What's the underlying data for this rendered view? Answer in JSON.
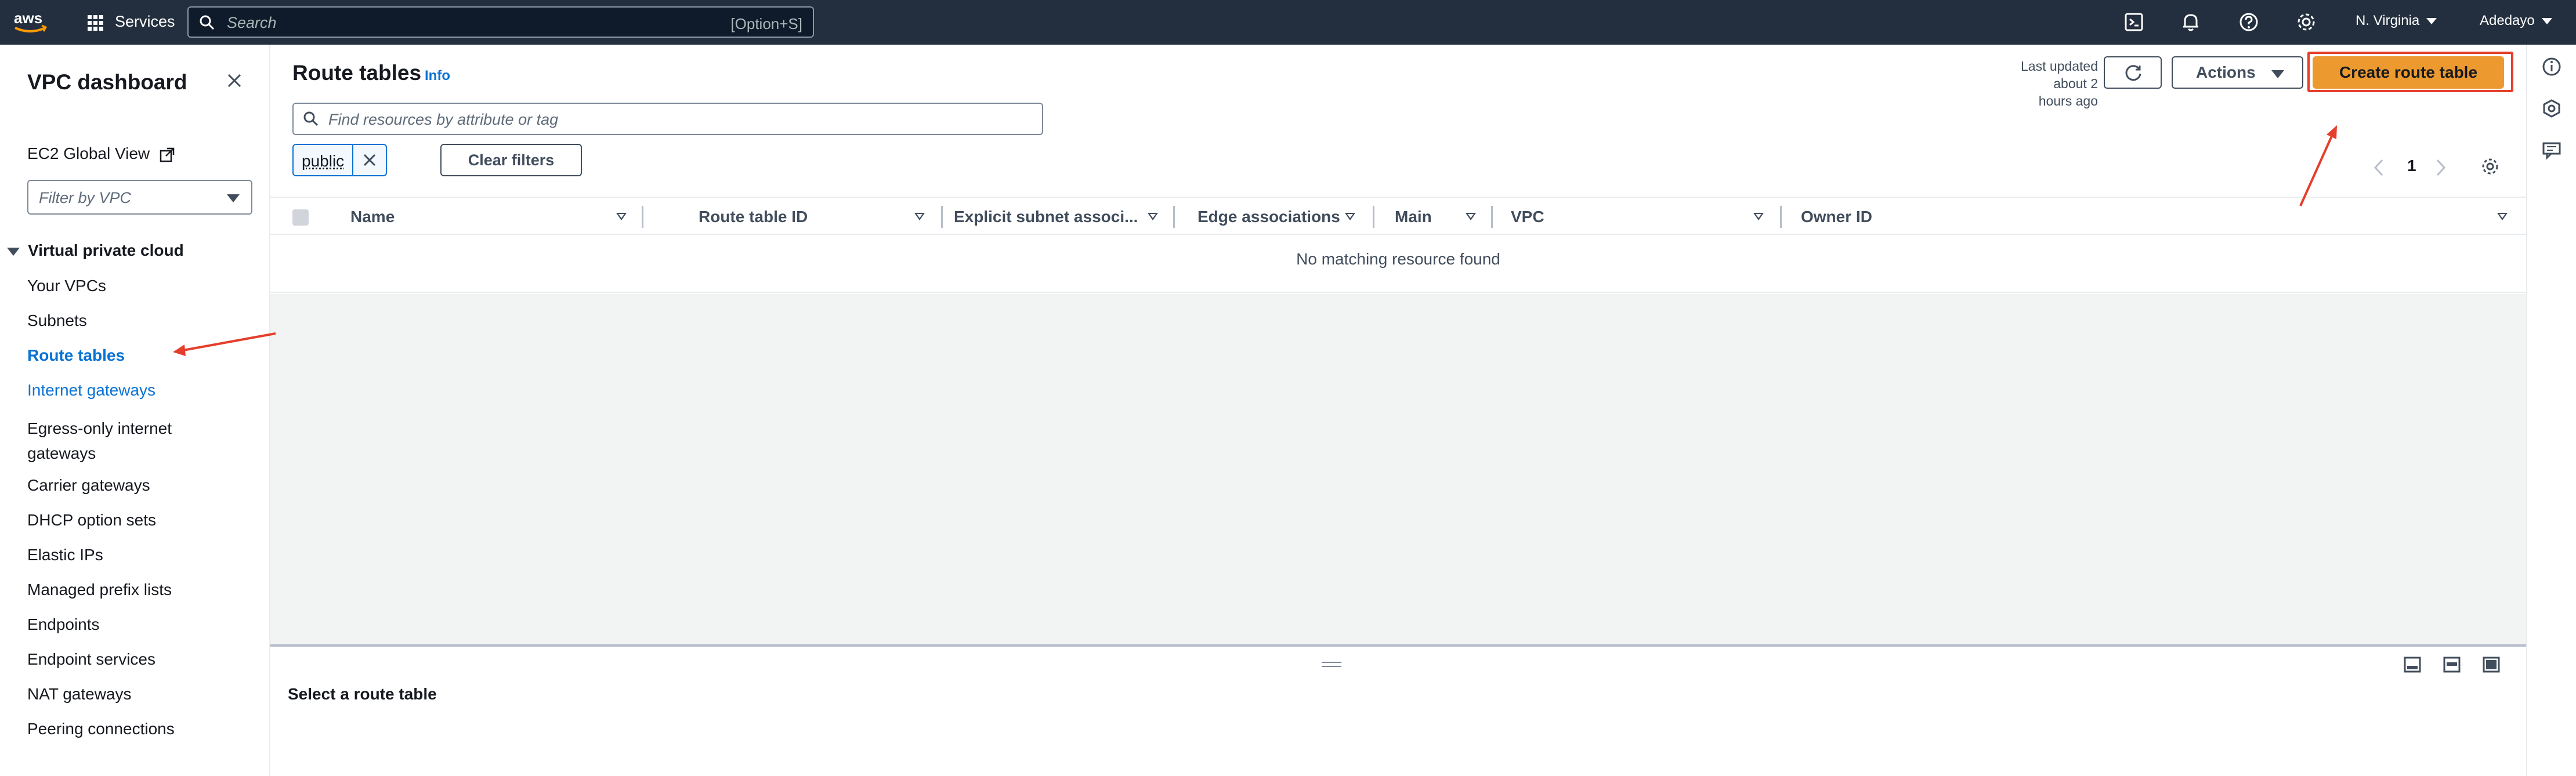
{
  "topnav": {
    "logo_text": "aws",
    "services_label": "Services",
    "search_placeholder": "Search",
    "search_shortcut": "[Option+S]",
    "region": "N. Virginia",
    "user": "Adedayo",
    "icons": [
      "cloudshell-icon",
      "notifications-icon",
      "help-icon",
      "settings-icon"
    ]
  },
  "sidebar": {
    "title": "VPC dashboard",
    "ec2_global_view": "EC2 Global View",
    "filter_placeholder": "Filter by VPC",
    "section": "Virtual private cloud",
    "items": [
      {
        "label": "Your VPCs"
      },
      {
        "label": "Subnets"
      },
      {
        "label": "Route tables"
      },
      {
        "label": "Internet gateways"
      },
      {
        "label": "Egress-only internet gateways"
      },
      {
        "label": "Carrier gateways"
      },
      {
        "label": "DHCP option sets"
      },
      {
        "label": "Elastic IPs"
      },
      {
        "label": "Managed prefix lists"
      },
      {
        "label": "Endpoints"
      },
      {
        "label": "Endpoint services"
      },
      {
        "label": "NAT gateways"
      },
      {
        "label": "Peering connections"
      }
    ]
  },
  "main": {
    "title": "Route tables",
    "info": "Info",
    "last_updated_1": "Last updated",
    "last_updated_2": "about 2 hours ago",
    "actions_label": "Actions",
    "create_label": "Create route table",
    "filter_placeholder": "Find resources by attribute or tag",
    "token": "public",
    "clear_filters": "Clear filters",
    "page": "1",
    "columns": [
      {
        "label": "Name"
      },
      {
        "label": "Route table ID"
      },
      {
        "label": "Explicit subnet associ..."
      },
      {
        "label": "Edge associations"
      },
      {
        "label": "Main"
      },
      {
        "label": "VPC"
      },
      {
        "label": "Owner ID"
      }
    ],
    "empty_message": "No matching resource found",
    "detail_title": "Select a route table"
  },
  "colors": {
    "nav_bg": "#232f3e",
    "link": "#0972d3",
    "primary_button": "#ec9a2f",
    "annotation": "#e53e2b"
  }
}
